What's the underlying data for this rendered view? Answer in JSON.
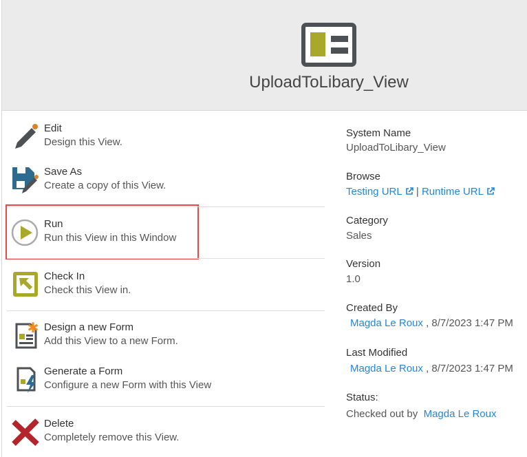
{
  "header": {
    "title": "UploadToLibary_View",
    "icon": "view-icon",
    "accent": "#a9a82a"
  },
  "actions": [
    {
      "title": "Edit",
      "desc": "Design this View.",
      "icon": "pencil-icon"
    },
    {
      "title": "Save As",
      "desc": "Create a copy of this View.",
      "icon": "save-as-icon"
    },
    {
      "title": "Run",
      "desc": "Run this View in this Window",
      "icon": "play-icon"
    },
    {
      "title": "Check In",
      "desc": "Check this View in.",
      "icon": "check-in-icon"
    },
    {
      "title": "Design a new Form",
      "desc": "Add this View to a new Form.",
      "icon": "new-form-icon"
    },
    {
      "title": "Generate a Form",
      "desc": "Configure a new Form with this View",
      "icon": "generate-form-icon"
    },
    {
      "title": "Delete",
      "desc": "Completely remove this View.",
      "icon": "delete-icon"
    }
  ],
  "details": {
    "system_name_label": "System Name",
    "system_name": "UploadToLibary_View",
    "browse_label": "Browse",
    "testing_url": "Testing URL",
    "separator": "|",
    "runtime_url": "Runtime URL",
    "category_label": "Category",
    "category": "Sales",
    "version_label": "Version",
    "version": "1.0",
    "created_by_label": "Created By",
    "created_by": "Magda Le Roux",
    "created_date": ", 8/7/2023 1:47 PM",
    "last_modified_label": "Last Modified",
    "modified_by": "Magda Le Roux",
    "modified_date": ", 8/7/2023 1:47 PM",
    "status_label": "Status:",
    "status": "Checked out by",
    "status_user": "Magda Le Roux"
  }
}
